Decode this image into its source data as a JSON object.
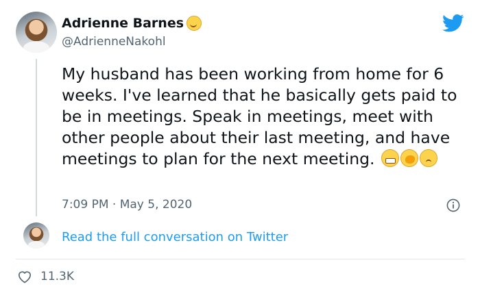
{
  "tweet": {
    "author_name": "Adrienne Barnes",
    "author_handle": "@AdrienneNakohl",
    "text": "My husband has been working from home for 6 weeks. I've learned that he basically gets paid to be in meetings. Speak in meetings, meet with other people about their last meeting, and have meetings to plan for the next meeting.",
    "timestamp": "7:09 PM · May 5, 2020",
    "like_count": "11.3K"
  },
  "conversation_link": {
    "label": "Read the full conversation on Twitter"
  },
  "icons": {
    "brand": "twitter-bird-icon",
    "info": "info-icon",
    "like": "heart-icon"
  },
  "colors": {
    "brand_blue": "#1d9bf0",
    "secondary_text": "#536471"
  }
}
